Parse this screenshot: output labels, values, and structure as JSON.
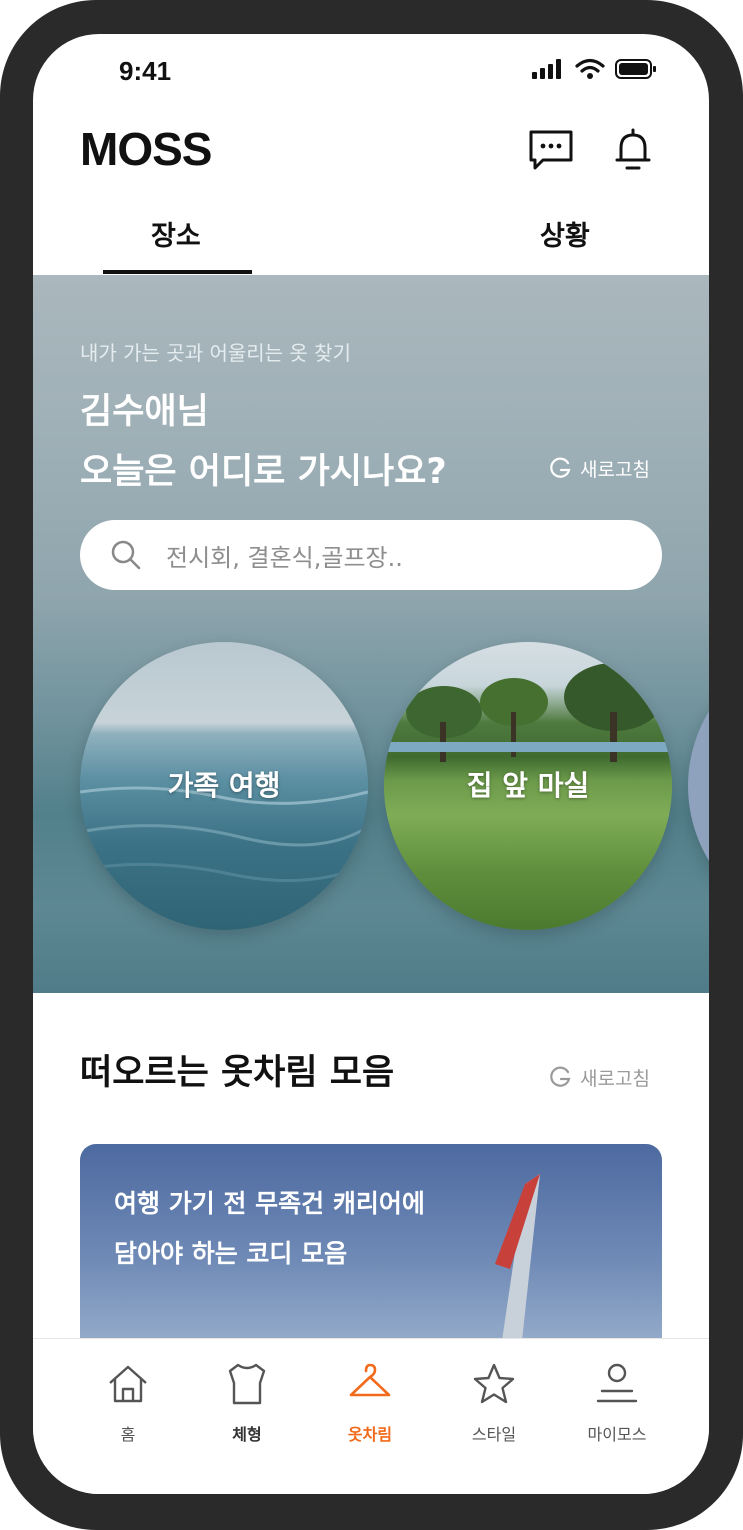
{
  "status_bar": {
    "time": "9:41"
  },
  "header": {
    "logo": "MOSS"
  },
  "tabs": [
    {
      "label": "장소",
      "active": true
    },
    {
      "label": "상황",
      "active": false
    }
  ],
  "hero": {
    "subtitle": "내가 가는 곳과 어울리는 옷 찾기",
    "title_line1": "김수애님",
    "title_line2": "오늘은 어디로 가시나요?",
    "refresh_label": "새로고침",
    "search_placeholder": "전시회, 결혼식,골프장.."
  },
  "places": [
    {
      "label": "가족 여행"
    },
    {
      "label": "집 앞 마실"
    }
  ],
  "section": {
    "title": "떠오르는 옷차림 모음",
    "refresh_label": "새로고침"
  },
  "card": {
    "title_line1": "여행 가기 전 무족건 캐리어에",
    "title_line2": "담아야 하는 코디 모음"
  },
  "bottom_nav": [
    {
      "label": "홈",
      "icon": "home-icon"
    },
    {
      "label": "체형",
      "icon": "body-shape-icon"
    },
    {
      "label": "옷차림",
      "icon": "hanger-icon",
      "active": true
    },
    {
      "label": "스타일",
      "icon": "star-icon"
    },
    {
      "label": "마이모스",
      "icon": "profile-icon"
    }
  ],
  "colors": {
    "accent": "#f26a1b",
    "device_frame": "#2a2a2a"
  }
}
